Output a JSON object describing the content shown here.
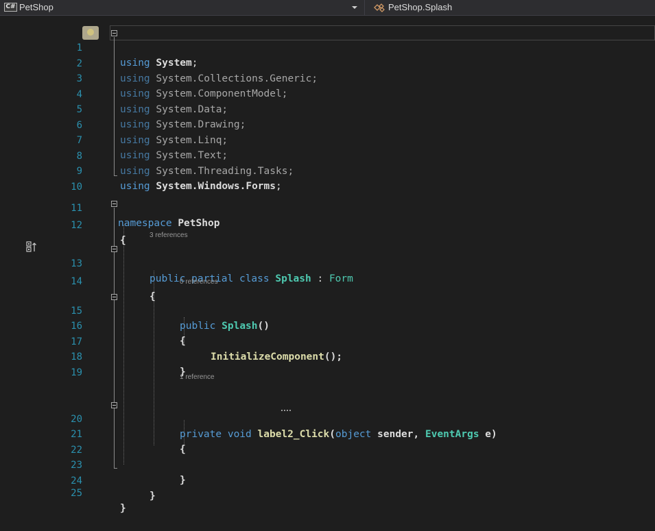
{
  "nav": {
    "project_icon": "C#",
    "project_name": "PetShop",
    "class_name": "PetShop.Splash",
    "class_icon": "class-icon"
  },
  "code_lenses": {
    "class_refs": "3 references",
    "ctor_refs": "0 references",
    "method_refs": "1 reference"
  },
  "line_numbers": [
    "1",
    "2",
    "3",
    "4",
    "5",
    "6",
    "7",
    "8",
    "9",
    "10",
    "11",
    "12",
    "13",
    "14",
    "15",
    "16",
    "17",
    "18",
    "19",
    "20",
    "21",
    "22",
    "23",
    "24",
    "25"
  ],
  "code": {
    "using_kw": "using",
    "l1_ns": "System",
    "l2_ns": "System.Collections.Generic",
    "l3_ns": "System.ComponentModel",
    "l4_ns": "System.Data",
    "l5_ns": "System.Drawing",
    "l6_ns": "System.Linq",
    "l7_ns": "System.Text",
    "l8_ns": "System.Threading.Tasks",
    "l9_ns": "System.Windows.Forms",
    "semicolon": ";",
    "namespace_kw": "namespace",
    "namespace_name": "PetShop",
    "open_brace": "{",
    "close_brace": "}",
    "public_kw": "public",
    "partial_kw": "partial",
    "class_kw": "class",
    "class_name": "Splash",
    "colon": ":",
    "base_type": "Form",
    "ctor_name": "Splash",
    "empty_parens": "()",
    "init_call": "InitializeComponent",
    "init_tail": "();",
    "private_kw": "private",
    "void_kw": "void",
    "method_name": "label2_Click",
    "open_paren": "(",
    "object_kw": "object",
    "param_sender": "sender",
    "comma": ",",
    "event_args_type": "EventArgs",
    "param_e": "e",
    "close_paren": ")"
  },
  "colors": {
    "background": "#1e1e1e",
    "keyword": "#569cd6",
    "type": "#4ec9b0",
    "method": "#dcdcaa",
    "line_number": "#2b91af"
  }
}
